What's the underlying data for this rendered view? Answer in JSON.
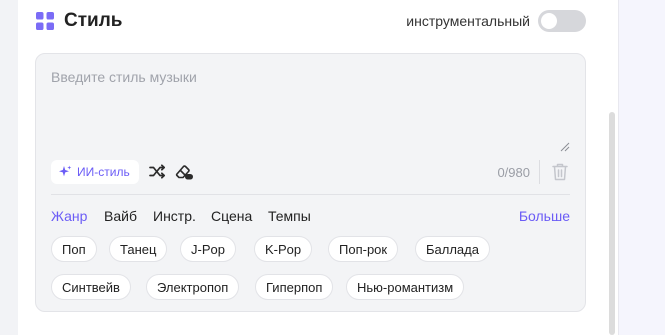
{
  "header": {
    "title": "Стиль",
    "toggle_label": "инструментальный",
    "toggle_on": false
  },
  "input": {
    "placeholder": "Введите стиль музыки",
    "value": ""
  },
  "toolbar": {
    "ai_style_label": "ИИ-стиль",
    "char_count": "0/980"
  },
  "tabs": [
    {
      "label": "Жанр",
      "active": true
    },
    {
      "label": "Вайб",
      "active": false
    },
    {
      "label": "Инстр.",
      "active": false
    },
    {
      "label": "Сцена",
      "active": false
    },
    {
      "label": "Темпы",
      "active": false
    }
  ],
  "more_label": "Больше",
  "chips": {
    "row1": [
      "Поп",
      "Танец",
      "J-Pop",
      "K-Pop",
      "Поп-рок",
      "Баллада"
    ],
    "row2": [
      "Синтвейв",
      "Электропоп",
      "Гиперпоп",
      "Нью-романтизм"
    ]
  },
  "colors": {
    "accent": "#6b5cf6",
    "card_bg": "#f3f4f6",
    "toggle_off": "#d6d7db"
  },
  "icons": {
    "header": "grid-squares-icon",
    "ai_style": "sparkle-icon",
    "shuffle": "shuffle-icon",
    "clear": "eraser-icon",
    "delete": "trash-icon"
  }
}
